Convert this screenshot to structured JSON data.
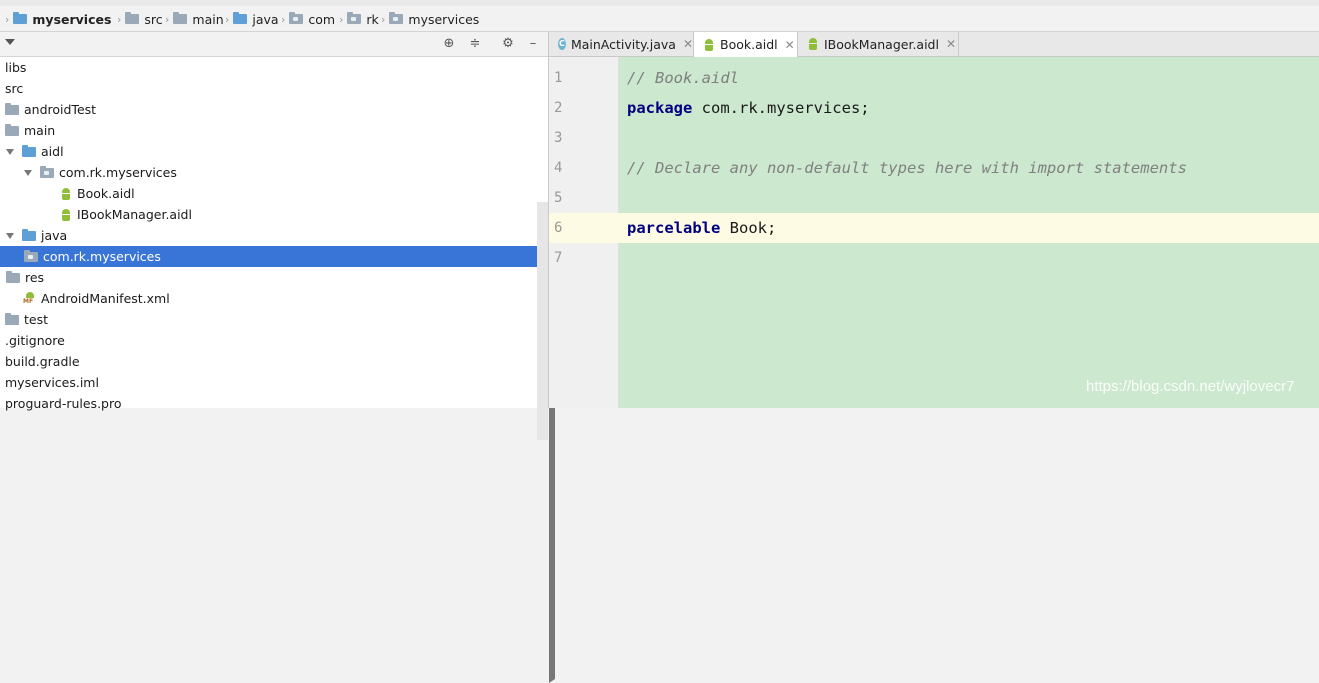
{
  "breadcrumb": {
    "items": [
      {
        "label": "myservices",
        "bold": true,
        "folder": "blue"
      },
      {
        "label": "src",
        "folder": "gray"
      },
      {
        "label": "main",
        "folder": "gray"
      },
      {
        "label": "java",
        "folder": "blue"
      },
      {
        "label": "com",
        "folder": "pkg"
      },
      {
        "label": "rk",
        "folder": "pkg"
      },
      {
        "label": "myservices",
        "folder": "pkg"
      }
    ]
  },
  "project_panel": {
    "tree": [
      {
        "label": "libs",
        "indent": 0,
        "twisty": "",
        "icon": ""
      },
      {
        "label": "src",
        "indent": 0,
        "twisty": "",
        "icon": ""
      },
      {
        "label": "androidTest",
        "indent": 0,
        "twisty": "",
        "icon": "folder-gray"
      },
      {
        "label": "main",
        "indent": 0,
        "twisty": "",
        "icon": "folder-gray"
      },
      {
        "label": "aidl",
        "indent": 0,
        "twisty": "down",
        "icon": "folder-blue"
      },
      {
        "label": "com.rk.myservices",
        "indent": 1,
        "twisty": "down",
        "icon": "folder-pkg"
      },
      {
        "label": "Book.aidl",
        "indent": 2,
        "twisty": "",
        "icon": "android"
      },
      {
        "label": "IBookManager.aidl",
        "indent": 2,
        "twisty": "",
        "icon": "android"
      },
      {
        "label": "java",
        "indent": 0,
        "twisty": "down",
        "icon": "folder-blue"
      },
      {
        "label": "com.rk.myservices",
        "indent": 1,
        "twisty": "right",
        "icon": "folder-pkg",
        "selected": true
      },
      {
        "label": "res",
        "indent": 0,
        "twisty": "right",
        "icon": "folder-gray"
      },
      {
        "label": "AndroidManifest.xml",
        "indent": 0,
        "twisty": "",
        "icon": "manifest"
      },
      {
        "label": "test",
        "indent": 0,
        "twisty": "",
        "icon": "folder-gray"
      },
      {
        "label": ".gitignore",
        "indent": 0,
        "twisty": "",
        "icon": ""
      },
      {
        "label": "build.gradle",
        "indent": 0,
        "twisty": "",
        "icon": ""
      },
      {
        "label": "myservices.iml",
        "indent": 0,
        "twisty": "",
        "icon": ""
      },
      {
        "label": "proguard-rules.pro",
        "indent": 0,
        "twisty": "",
        "icon": ""
      }
    ],
    "manifest_badge": "MF",
    "toolbar_icons": [
      "target-icon",
      "collapse-icon",
      "gear-icon",
      "minimize-icon"
    ],
    "toolbar_glyphs": {
      "target": "⊕",
      "collapse": "≑",
      "gear": "⚙",
      "minimize": "–"
    }
  },
  "editor": {
    "tabs": [
      {
        "label": "MainActivity.java",
        "icon": "class-icon",
        "glyph": "C",
        "active": false
      },
      {
        "label": "Book.aidl",
        "icon": "android-icon",
        "active": true
      },
      {
        "label": "IBookManager.aidl",
        "icon": "android-icon",
        "active": false
      }
    ],
    "close_glyph": "✕",
    "lines": [
      {
        "num": "1",
        "segments": [
          {
            "text": "// Book.aidl",
            "cls": "cmt"
          }
        ]
      },
      {
        "num": "2",
        "segments": [
          {
            "text": "package",
            "cls": "kw"
          },
          {
            "text": " com.rk.myservices;",
            "cls": ""
          }
        ]
      },
      {
        "num": "3",
        "segments": []
      },
      {
        "num": "4",
        "segments": [
          {
            "text": "// Declare any non-default types here with import statements",
            "cls": "cmt"
          }
        ]
      },
      {
        "num": "5",
        "segments": []
      },
      {
        "num": "6",
        "current": true,
        "segments": [
          {
            "text": "parcelable",
            "cls": "kw"
          },
          {
            "text": " Book;",
            "cls": ""
          }
        ]
      },
      {
        "num": "7",
        "segments": []
      }
    ]
  },
  "watermark": "https://blog.csdn.net/wyjlovecr7",
  "colors": {
    "selection": "#3875d7",
    "editor_bg": "#cce8cf",
    "current_line": "#fdfbe3"
  }
}
